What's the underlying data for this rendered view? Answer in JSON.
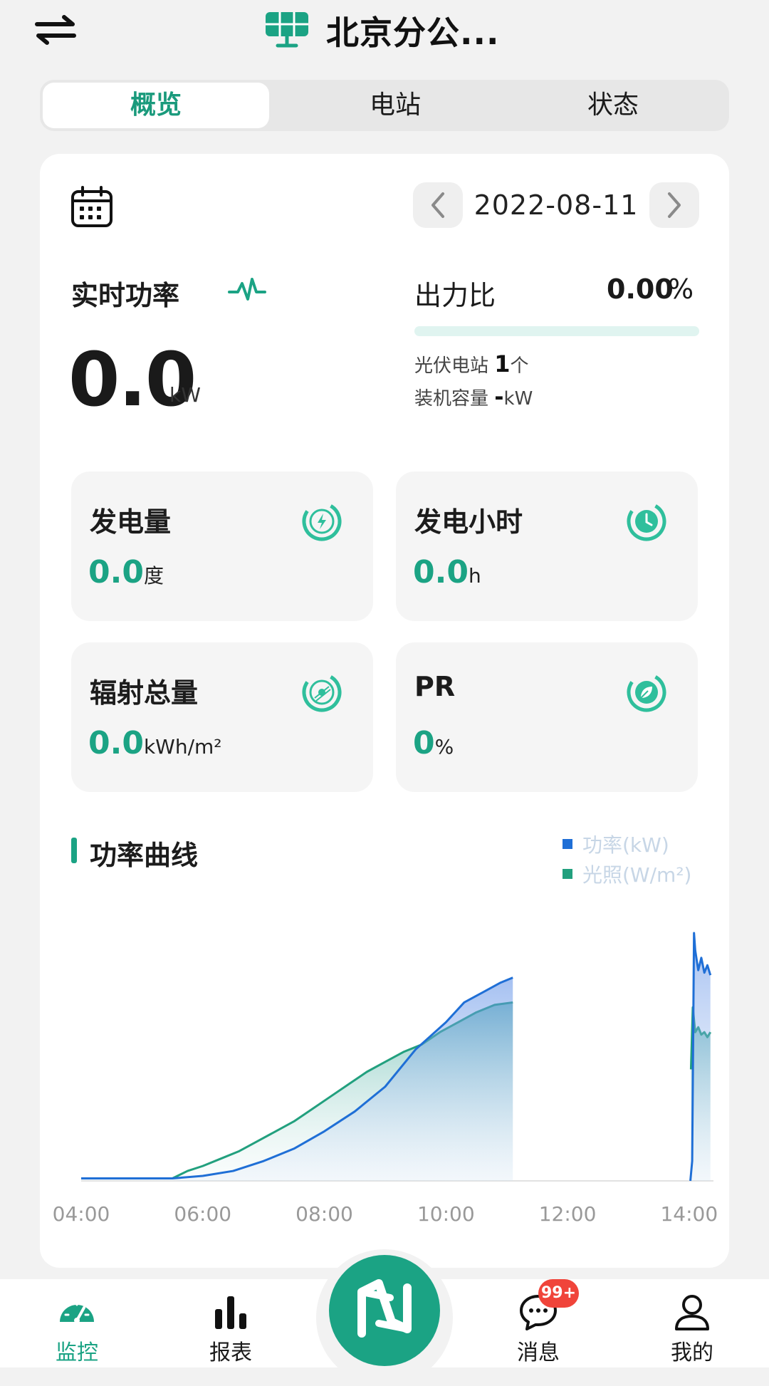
{
  "header": {
    "title": "北京分公..."
  },
  "tabs": [
    {
      "label": "概览",
      "active": true
    },
    {
      "label": "电站",
      "active": false
    },
    {
      "label": "状态",
      "active": false
    }
  ],
  "date": {
    "value": "2022-08-11"
  },
  "realtime": {
    "label": "实时功率",
    "value": "0.0",
    "unit": "kW"
  },
  "output_ratio": {
    "label": "出力比",
    "value": "0.00",
    "pct_sign": "%",
    "fill_percent": 0
  },
  "stations": {
    "pv_label": "光伏电站 ",
    "pv_count": "1",
    "pv_unit": "个",
    "capacity_label": "装机容量 ",
    "capacity_value": "-",
    "capacity_unit": "kW"
  },
  "stats": [
    {
      "label": "发电量",
      "value": "0.0",
      "unit": "度",
      "icon": "lightning-ring-icon"
    },
    {
      "label": "发电小时",
      "value": "0.0",
      "unit": "h",
      "icon": "clock-ring-icon"
    },
    {
      "label": "辐射总量",
      "value": "0.0",
      "unit": "kWh/m²",
      "icon": "sun-ring-icon"
    },
    {
      "label": "PR",
      "value": "0",
      "unit": "%",
      "icon": "leaf-ring-icon"
    }
  ],
  "colors": {
    "accent": "#1ba384",
    "power_series": "#1f6fd6",
    "light_series": "#22a07e",
    "badge": "#f0443a"
  },
  "nav": {
    "items": [
      {
        "label": "监控",
        "icon": "gauge-icon",
        "active": true
      },
      {
        "label": "报表",
        "icon": "bar-chart-icon",
        "active": false
      },
      {
        "label": "消息",
        "icon": "chat-bubble-icon",
        "active": false
      },
      {
        "label": "我的",
        "icon": "user-icon",
        "active": false
      }
    ],
    "badge": "99+",
    "center_icon": "brand-logo-icon"
  },
  "chart_data": {
    "type": "area",
    "title": "功率曲线",
    "xlabel": "",
    "ylabel": "",
    "x_ticks": [
      "04:00",
      "06:00",
      "08:00",
      "10:00",
      "12:00",
      "14:00"
    ],
    "xlim": [
      4,
      14.4
    ],
    "ylim": [
      0,
      1
    ],
    "grid": false,
    "legend": "top-right",
    "series": [
      {
        "name": "功率(kW)",
        "color": "#1f6fd6",
        "x": [
          4.0,
          5.0,
          5.5,
          6.0,
          6.5,
          7.0,
          7.5,
          8.0,
          8.5,
          9.0,
          9.5,
          10.0,
          10.3,
          10.6,
          10.9,
          11.1,
          14.02,
          14.05,
          14.08,
          14.1,
          14.15,
          14.2,
          14.25,
          14.3,
          14.35
        ],
        "y": [
          0.01,
          0.01,
          0.01,
          0.02,
          0.04,
          0.08,
          0.13,
          0.2,
          0.28,
          0.38,
          0.53,
          0.64,
          0.72,
          0.76,
          0.8,
          0.82,
          0.0,
          0.08,
          1.0,
          0.93,
          0.85,
          0.9,
          0.84,
          0.87,
          0.83
        ],
        "gap_after_index": 15
      },
      {
        "name": "光照(W/m²)",
        "color": "#22a07e",
        "x": [
          4.0,
          5.0,
          5.5,
          5.75,
          6.0,
          6.3,
          6.6,
          6.9,
          7.2,
          7.5,
          7.8,
          8.1,
          8.4,
          8.7,
          9.0,
          9.3,
          9.6,
          9.9,
          10.2,
          10.5,
          10.8,
          11.1,
          14.03,
          14.06,
          14.1,
          14.15,
          14.2,
          14.25,
          14.3,
          14.35
        ],
        "y": [
          0.01,
          0.01,
          0.01,
          0.04,
          0.06,
          0.09,
          0.12,
          0.16,
          0.2,
          0.24,
          0.29,
          0.34,
          0.39,
          0.44,
          0.48,
          0.52,
          0.55,
          0.6,
          0.64,
          0.68,
          0.71,
          0.72,
          0.45,
          0.7,
          0.6,
          0.62,
          0.59,
          0.6,
          0.58,
          0.6
        ],
        "gap_after_index": 21
      }
    ]
  }
}
